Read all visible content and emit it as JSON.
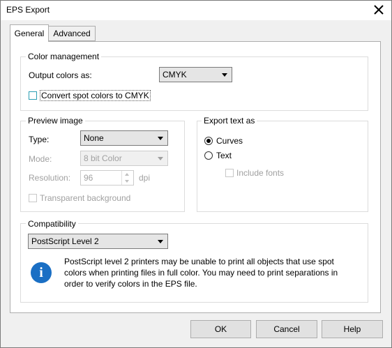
{
  "window": {
    "title": "EPS Export"
  },
  "tabs": [
    {
      "label": "General",
      "active": true
    },
    {
      "label": "Advanced",
      "active": false
    }
  ],
  "color_management": {
    "title": "Color management",
    "output_label": "Output colors as:",
    "output_value": "CMYK",
    "convert_spot_label": "Convert spot colors to CMYK"
  },
  "preview_image": {
    "title": "Preview image",
    "type_label": "Type:",
    "type_value": "None",
    "mode_label": "Mode:",
    "mode_value": "8 bit Color",
    "resolution_label": "Resolution:",
    "resolution_value": "96",
    "resolution_unit": "dpi",
    "transparent_label": "Transparent background"
  },
  "export_text": {
    "title": "Export text as",
    "curves_label": "Curves",
    "text_label": "Text",
    "include_fonts_label": "Include fonts",
    "selected": "Curves"
  },
  "compatibility": {
    "title": "Compatibility",
    "value": "PostScript Level 2",
    "info_icon": "i",
    "info_line1": "PostScript level 2 printers may be unable to print all objects that use spot",
    "info_line2": "colors when printing files in full color. You may need to print separations in",
    "info_line3": "order to verify colors in the EPS file."
  },
  "buttons": {
    "ok": "OK",
    "cancel": "Cancel",
    "help": "Help"
  },
  "colors": {
    "accent": "#2b9eb3",
    "info_icon": "#1a6fc4"
  }
}
